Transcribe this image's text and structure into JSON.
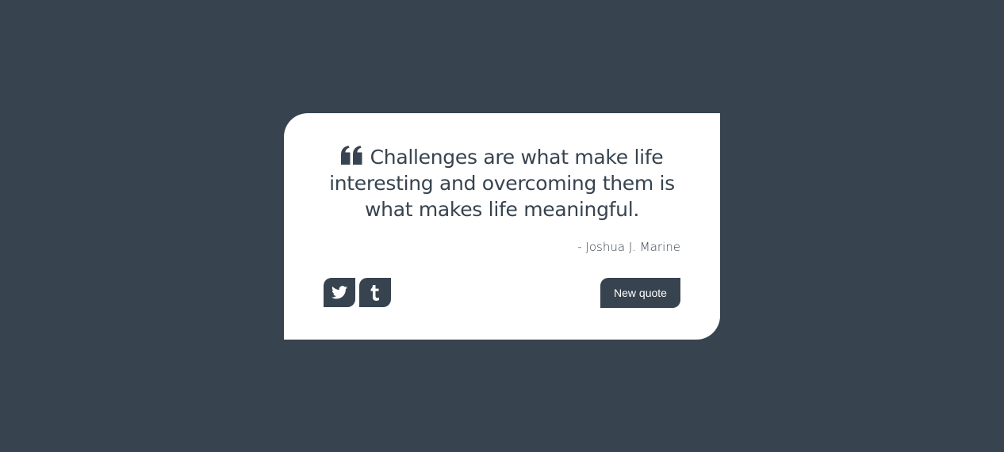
{
  "quote": {
    "text": "Challenges are what make life interesting and overcoming them is what makes life meaningful.",
    "author": "- Joshua J. Marine",
    "icon": "quote-left-icon"
  },
  "share": {
    "twitter_icon": "twitter-icon",
    "tumblr_icon": "tumblr-icon"
  },
  "actions": {
    "new_quote_label": "New quote"
  },
  "colors": {
    "background": "#37434f",
    "card": "#ffffff",
    "accent": "#37434f"
  }
}
